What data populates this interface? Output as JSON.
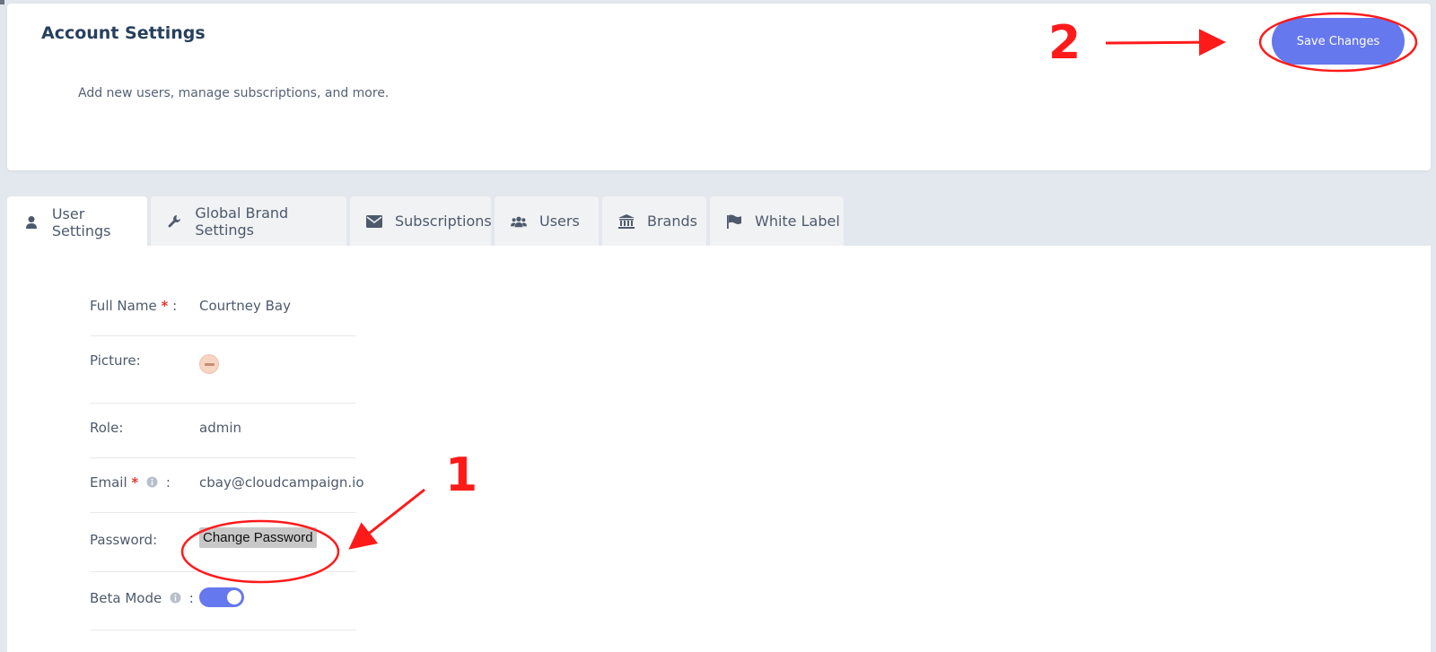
{
  "header": {
    "title": "Account Settings",
    "subtitle": "Add new users, manage subscriptions, and more.",
    "save_label": "Save Changes"
  },
  "tabs": [
    {
      "label": "User Settings",
      "icon": "user-icon",
      "active": true
    },
    {
      "label": "Global Brand Settings",
      "icon": "wrench-icon",
      "active": false
    },
    {
      "label": "Subscriptions",
      "icon": "envelope-icon",
      "active": false
    },
    {
      "label": "Users",
      "icon": "users-icon",
      "active": false
    },
    {
      "label": "Brands",
      "icon": "bank-icon",
      "active": false
    },
    {
      "label": "White Label",
      "icon": "flag-icon",
      "active": false
    }
  ],
  "form": {
    "full_name": {
      "label": "Full Name",
      "required_mark": "*",
      "colon": ":",
      "value": "Courtney Bay"
    },
    "picture": {
      "label": "Picture:"
    },
    "role": {
      "label": "Role:",
      "value": "admin"
    },
    "email": {
      "label": "Email",
      "required_mark": "*",
      "colon": ":",
      "value": "cbay@cloudcampaign.io"
    },
    "password": {
      "label": "Password:",
      "button_label": "Change Password"
    },
    "beta_mode": {
      "label": "Beta Mode",
      "colon": ":",
      "enabled": true
    }
  },
  "annotations": {
    "marker_1": "1",
    "marker_2": "2",
    "color": "#ff1a1a"
  },
  "colors": {
    "accent": "#6678ee",
    "title": "#27405e",
    "background": "#e3e7ee",
    "required": "#e53935"
  }
}
